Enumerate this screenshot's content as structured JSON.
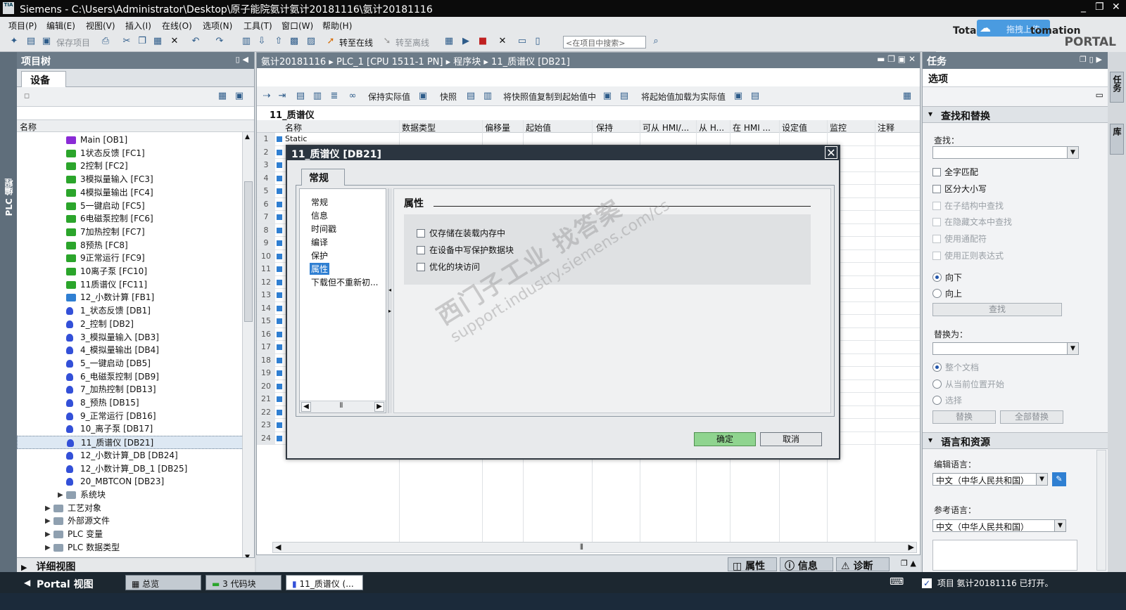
{
  "titlebar": {
    "logo": "TIA",
    "title": "Siemens  -  C:\\Users\\Administrator\\Desktop\\原子能院氨计氨计20181116\\氨计20181116",
    "controls": [
      "_",
      "❐",
      "✕"
    ]
  },
  "menubar": {
    "items": [
      "项目(P)",
      "编辑(E)",
      "视图(V)",
      "插入(I)",
      "在线(O)",
      "选项(N)",
      "工具(T)",
      "窗口(W)",
      "帮助(H)"
    ]
  },
  "brand": {
    "line1": "Totally Integrated Automation",
    "line1_visible": "Total",
    "line1_tail": "tomation",
    "line2": "PORTAL",
    "upload_label": "拖拽上传"
  },
  "toolbar": {
    "save_project": "保存项目",
    "go_online": "转至在线",
    "go_offline": "转至离线",
    "search_placeholder": "<在项目中搜索>"
  },
  "left_vtab": {
    "label": "PLC 编程"
  },
  "project_tree": {
    "title": "项目树",
    "tab_devices": "设备",
    "col_name": "名称",
    "items": [
      {
        "label": "Main [OB1]",
        "type": "ob"
      },
      {
        "label": "1状态反馈 [FC1]",
        "type": "fc"
      },
      {
        "label": "2控制 [FC2]",
        "type": "fc"
      },
      {
        "label": "3模拟量输入 [FC3]",
        "type": "fc"
      },
      {
        "label": "4模拟量输出 [FC4]",
        "type": "fc"
      },
      {
        "label": "5一键启动 [FC5]",
        "type": "fc"
      },
      {
        "label": "6电磁泵控制 [FC6]",
        "type": "fc"
      },
      {
        "label": "7加热控制 [FC7]",
        "type": "fc"
      },
      {
        "label": "8预热 [FC8]",
        "type": "fc"
      },
      {
        "label": "9正常运行 [FC9]",
        "type": "fc"
      },
      {
        "label": "10离子泵 [FC10]",
        "type": "fc"
      },
      {
        "label": "11质谱仪 [FC11]",
        "type": "fc"
      },
      {
        "label": "12_小数计算 [FB1]",
        "type": "fb"
      },
      {
        "label": "1_状态反馈 [DB1]",
        "type": "db"
      },
      {
        "label": "2_控制 [DB2]",
        "type": "db"
      },
      {
        "label": "3_模拟量输入 [DB3]",
        "type": "db"
      },
      {
        "label": "4_模拟量输出 [DB4]",
        "type": "db"
      },
      {
        "label": "5_一键启动 [DB5]",
        "type": "db"
      },
      {
        "label": "6_电磁泵控制 [DB9]",
        "type": "db"
      },
      {
        "label": "7_加热控制 [DB13]",
        "type": "db"
      },
      {
        "label": "8_预热 [DB15]",
        "type": "db"
      },
      {
        "label": "9_正常运行 [DB16]",
        "type": "db"
      },
      {
        "label": "10_离子泵 [DB17]",
        "type": "db"
      },
      {
        "label": "11_质谱仪 [DB21]",
        "type": "db"
      },
      {
        "label": "12_小数计算_DB [DB24]",
        "type": "db"
      },
      {
        "label": "12_小数计算_DB_1 [DB25]",
        "type": "db"
      },
      {
        "label": "20_MBTCON [DB23]",
        "type": "db"
      },
      {
        "label": "系统块",
        "type": "folder"
      },
      {
        "label": "工艺对象",
        "type": "folder"
      },
      {
        "label": "外部源文件",
        "type": "folder"
      },
      {
        "label": "PLC 变量",
        "type": "folder"
      },
      {
        "label": "PLC 数据类型",
        "type": "folder"
      }
    ],
    "detail_view": "详细视图"
  },
  "editor": {
    "breadcrumb": "氨计20181116  ▸  PLC_1 [CPU 1511-1 PN]  ▸  程序块  ▸  11_质谱仪 [DB21]",
    "toolbar": {
      "keep_actual": "保持实际值",
      "snapshot": "快照",
      "copy_snapshot": "将快照值复制到起始值中",
      "load_start": "将起始值加载为实际值"
    },
    "block_title": "11_质谱仪",
    "columns": [
      "名称",
      "数据类型",
      "偏移量",
      "起始值",
      "保持",
      "可从 HMI/...",
      "从 H...",
      "在 HMI ...",
      "设定值",
      "监控",
      "注释"
    ],
    "row1_name": "Static",
    "row_numbers": [
      "1",
      "2",
      "3",
      "4",
      "5",
      "6",
      "7",
      "8",
      "9",
      "10",
      "11",
      "12",
      "13",
      "14",
      "15",
      "16",
      "17",
      "18",
      "19",
      "20",
      "21",
      "22",
      "23",
      "24"
    ]
  },
  "dialog": {
    "title": "11_质谱仪 [DB21]",
    "close": "✕",
    "tab": "常规",
    "nav": [
      "常规",
      "信息",
      "时间戳",
      "编译",
      "保护",
      "属性",
      "下载但不重新初..."
    ],
    "selected_nav": "属性",
    "section_title": "属性",
    "options": [
      {
        "label": "仅存储在装载内存中",
        "checked": false
      },
      {
        "label": "在设备中写保护数据块",
        "checked": false
      },
      {
        "label": "优化的块访问",
        "checked": false
      }
    ],
    "ok": "确定",
    "cancel": "取消"
  },
  "watermark": {
    "line1": "西门子工业  找答案",
    "line2": "support.industry.siemens.com/cs"
  },
  "inspector_tabs": {
    "properties": "属性",
    "info": "信息",
    "diagnostics": "诊断"
  },
  "task_panel": {
    "title": "任务",
    "options": "选项",
    "find_replace": {
      "header": "查找和替换",
      "find_label": "查找：",
      "checks": [
        {
          "label": "全字匹配",
          "enabled": true
        },
        {
          "label": "区分大小写",
          "enabled": true
        },
        {
          "label": "在子结构中查找",
          "enabled": false
        },
        {
          "label": "在隐藏文本中查找",
          "enabled": false
        },
        {
          "label": "使用通配符",
          "enabled": false
        },
        {
          "label": "使用正则表达式",
          "enabled": false
        }
      ],
      "down": "向下",
      "up": "向上",
      "find_button": "查找",
      "replace_label": "替换为：",
      "scope": [
        "整个文档",
        "从当前位置开始",
        "选择"
      ],
      "replace_button": "替换",
      "replace_all_button": "全部替换"
    },
    "language": {
      "header": "语言和资源",
      "edit_lang_label": "编辑语言：",
      "edit_lang": "中文（中华人民共和国）",
      "ref_lang_label": "参考语言：",
      "ref_lang": "中文（中华人民共和国）"
    }
  },
  "right_vtabs": [
    "任务",
    "库"
  ],
  "statusbar": {
    "portal_view": "Portal 视图",
    "tabs": [
      "总览",
      "3 代码块",
      "11_质谱仪 (..."
    ],
    "message": "项目 氨计20181116 已打开。"
  }
}
